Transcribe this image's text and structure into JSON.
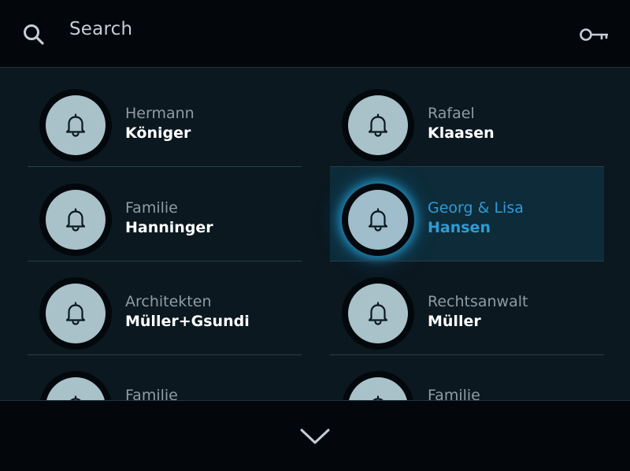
{
  "header": {
    "search_label": "Search",
    "search_icon": "search-icon",
    "key_icon": "key-icon"
  },
  "list": {
    "bell_icon": "bell-icon",
    "entries": [
      {
        "first": "Hermann",
        "last": "Königer",
        "selected": false
      },
      {
        "first": "Rafael",
        "last": "Klaasen",
        "selected": false
      },
      {
        "first": "Familie",
        "last": "Hanninger",
        "selected": false
      },
      {
        "first": "Georg & Lisa",
        "last": "Hansen",
        "selected": true
      },
      {
        "first": "Architekten",
        "last": "Müller+Gsundi",
        "selected": false
      },
      {
        "first": "Rechtsanwalt",
        "last": "Müller",
        "selected": false
      },
      {
        "first": "Familie",
        "last": "",
        "selected": false
      },
      {
        "first": "Familie",
        "last": "",
        "selected": false
      }
    ]
  },
  "footer": {
    "scroll_icon": "chevron-down-icon"
  },
  "colors": {
    "background": "#03070b",
    "list_background": "#0b1820",
    "accent": "#2f9bd6",
    "bell_circle": "#a9c1c8"
  }
}
